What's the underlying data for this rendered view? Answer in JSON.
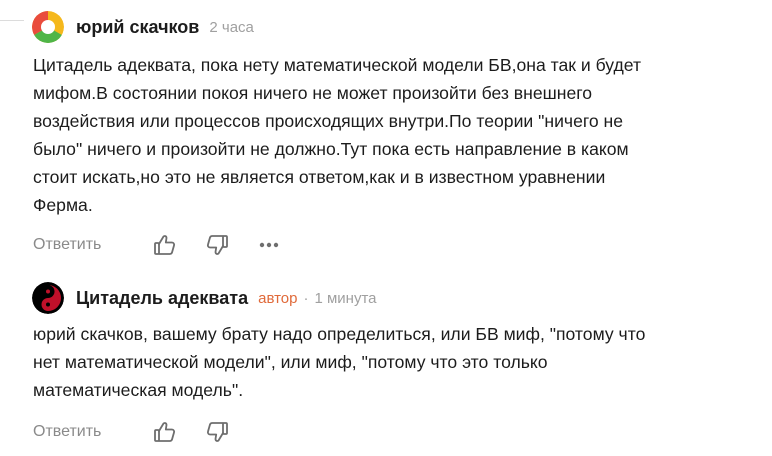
{
  "comments": [
    {
      "author": "юрий скачков",
      "time": "2 часа",
      "text": "Цитадель адеквата, пока нету математической модели БВ,она так и будет\nмифом.В состоянии покоя ничего не может произойти без внешнего\nвоздействия или процессов происходящих внутри.По теории \"ничего не\nбыло\" ничего и произойти не должно.Тут пока есть направление в каком\nстоит искать,но это не является ответом,как и в известном уравнении\nФерма.",
      "reply_label": "Ответить",
      "avatar_icon": "pie-avatar-icon",
      "avatar_colors": [
        "#e94c3d",
        "#f5b81c",
        "#4fb548",
        "#ffffff"
      ]
    },
    {
      "author": "Цитадель адеквата",
      "author_tag": "автор",
      "separator": "·",
      "time": "1 минута",
      "text": "юрий скачков, вашему брату надо определиться, или БВ миф, \"потому что\nнет математической модели\", или миф, \"потому что это только\nматематическая модель\".",
      "reply_label": "Ответить",
      "avatar_icon": "yin-yang-avatar-icon",
      "avatar_colors": [
        "#000000",
        "#c0102a"
      ]
    }
  ],
  "colors": {
    "text": "#1c1c1c",
    "muted": "#8a8a8a",
    "author_tag": "#e06a3a"
  },
  "icons": {
    "like": "thumbs-up-icon",
    "dislike": "thumbs-down-icon",
    "more": "more-dots-icon"
  }
}
